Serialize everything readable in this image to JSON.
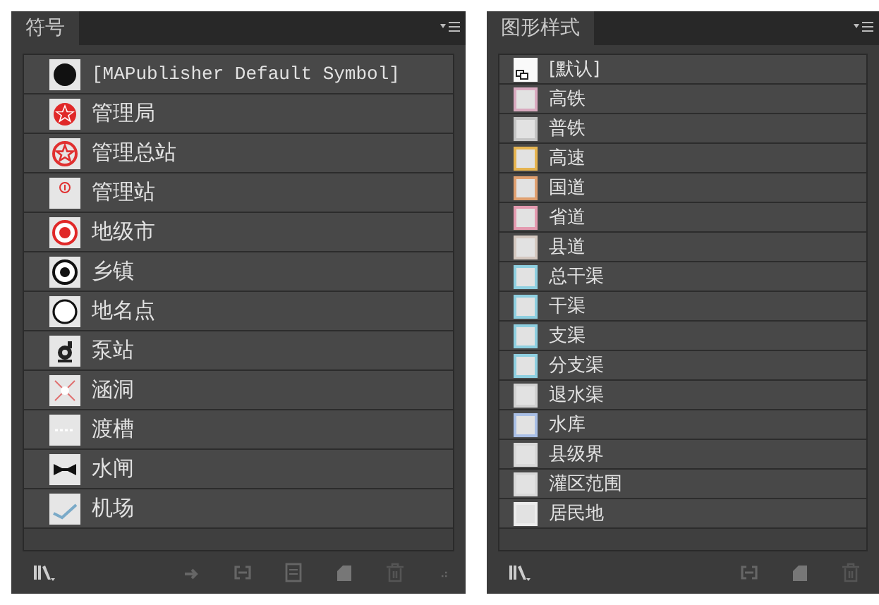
{
  "symbols_panel": {
    "tab": "符号",
    "items": [
      {
        "label": "[MAPublisher Default Symbol]",
        "kind": "filled-dot"
      },
      {
        "label": "管理局",
        "kind": "star-filled"
      },
      {
        "label": "管理总站",
        "kind": "star-outline"
      },
      {
        "label": "管理站",
        "kind": "small-mark"
      },
      {
        "label": "地级市",
        "kind": "red-target"
      },
      {
        "label": "乡镇",
        "kind": "black-target"
      },
      {
        "label": "地名点",
        "kind": "ring"
      },
      {
        "label": "泵站",
        "kind": "pump"
      },
      {
        "label": "涵洞",
        "kind": "cross"
      },
      {
        "label": "渡槽",
        "kind": "dashes"
      },
      {
        "label": "水闸",
        "kind": "bowtie"
      },
      {
        "label": "机场",
        "kind": "plane"
      }
    ]
  },
  "styles_panel": {
    "tab": "图形样式",
    "items": [
      {
        "label": "[默认]",
        "kind": "default"
      },
      {
        "label": "高铁",
        "kind": "swatch",
        "color": "#d9aac0"
      },
      {
        "label": "普铁",
        "kind": "swatch",
        "color": "#c4c4c4"
      },
      {
        "label": "高速",
        "kind": "swatch",
        "color": "#e6b450"
      },
      {
        "label": "国道",
        "kind": "swatch",
        "color": "#e0a070"
      },
      {
        "label": "省道",
        "kind": "swatch",
        "color": "#e49ab0"
      },
      {
        "label": "县道",
        "kind": "swatch",
        "color": "#d4c8c0"
      },
      {
        "label": "总干渠",
        "kind": "swatch",
        "color": "#8ecfe0"
      },
      {
        "label": "干渠",
        "kind": "swatch",
        "color": "#8ecfe0"
      },
      {
        "label": "支渠",
        "kind": "swatch",
        "color": "#8ecfe0"
      },
      {
        "label": "分支渠",
        "kind": "swatch",
        "color": "#8ecfe0"
      },
      {
        "label": "退水渠",
        "kind": "swatch",
        "color": "#d2d2d2"
      },
      {
        "label": "水库",
        "kind": "swatch",
        "color": "#a9bfe6"
      },
      {
        "label": "县级界",
        "kind": "swatch",
        "color": "#d8d8d8"
      },
      {
        "label": "灌区范围",
        "kind": "swatch",
        "color": "#d8d8d8"
      },
      {
        "label": "居民地",
        "kind": "swatch",
        "color": "#ececec"
      }
    ]
  }
}
